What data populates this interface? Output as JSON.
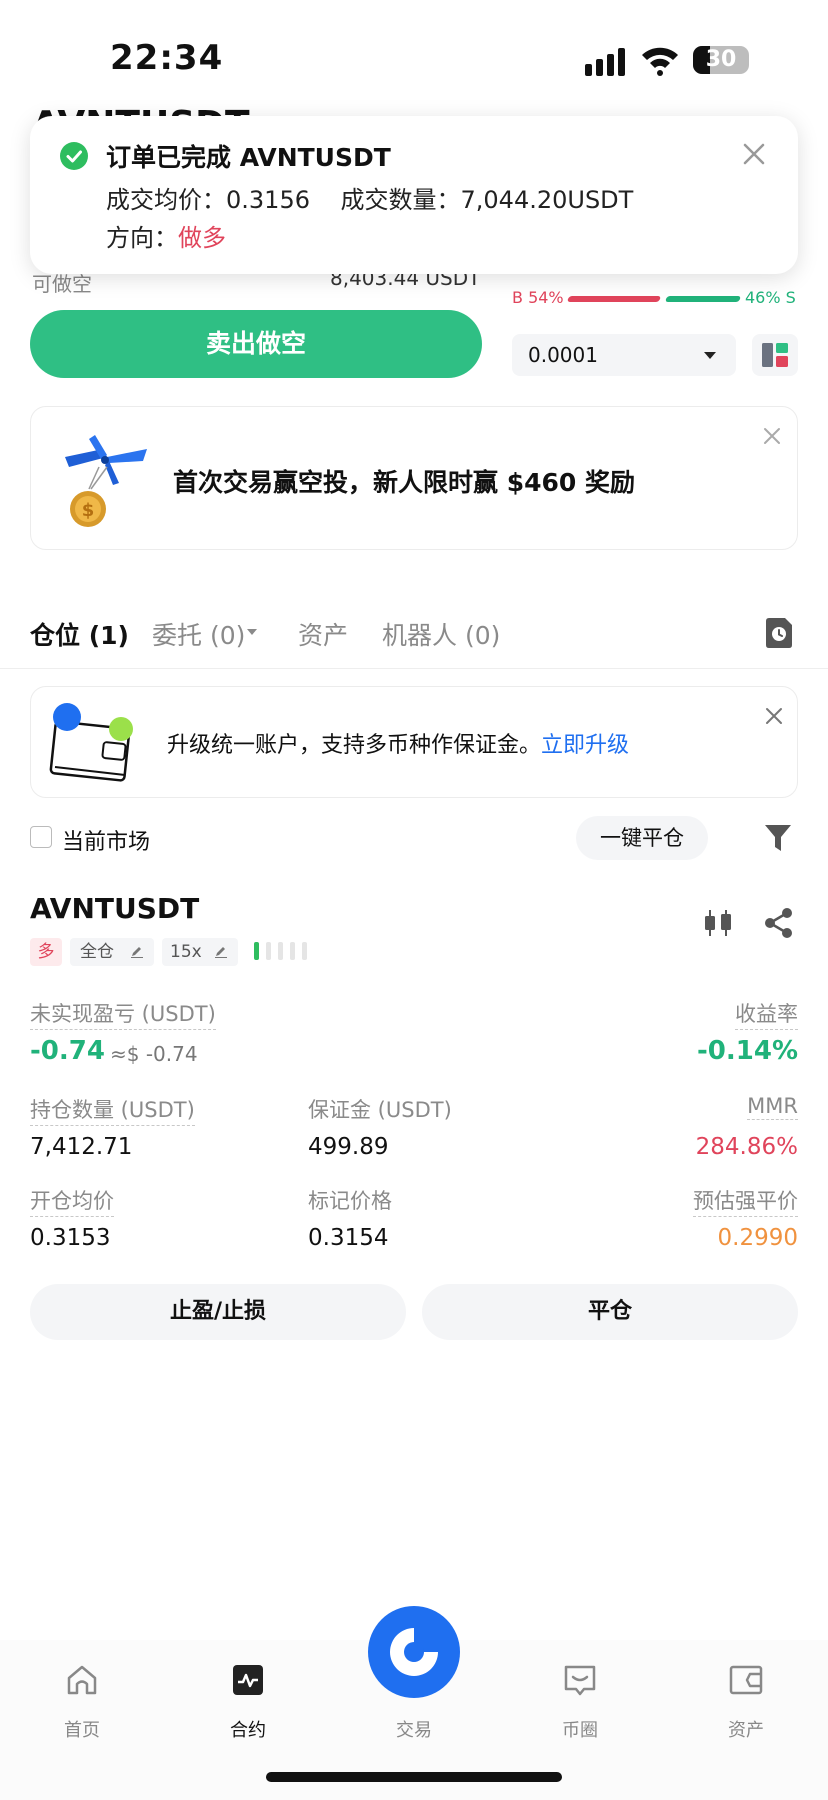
{
  "status_bar": {
    "time": "22:34",
    "battery": "30"
  },
  "header": {
    "pair": "AVNTUSDT"
  },
  "toast": {
    "title": "订单已完成 AVNTUSDT",
    "avg_price_label": "成交均价：",
    "avg_price": "0.3156",
    "qty_label": "成交数量：",
    "qty": "7,044.20USDT",
    "direction_label": "方向：",
    "direction": "做多"
  },
  "order_panel": {
    "available_label": "可做空",
    "available_value": "8,403.44 USDT",
    "buy_ratio": "B 54%",
    "sell_ratio": "46% S",
    "buy_ratio_fraction": 0.54,
    "sell_button": "卖出做空",
    "precision": "0.0001"
  },
  "promo": {
    "text": "首次交易赢空投，新人限时赢 $460 奖励"
  },
  "tabs": [
    {
      "label": "仓位 (1)"
    },
    {
      "label": "委托 (0)"
    },
    {
      "label": "资产"
    },
    {
      "label": "机器人 (0)"
    }
  ],
  "upgrade": {
    "text": "升级统一账户，支持多币种作保证金。",
    "link": "立即升级"
  },
  "filter_bar": {
    "current_market": "当前市场",
    "close_all": "一键平仓"
  },
  "position": {
    "symbol": "AVNTUSDT",
    "side_tag": "多",
    "margin_mode": "全仓",
    "leverage": "15x",
    "unrealized_pnl_label": "未实现盈亏 (USDT)",
    "unrealized_pnl": "-0.74",
    "unrealized_pnl_usd": "≈$ -0.74",
    "roe_label": "收益率",
    "roe": "-0.14%",
    "size_label": "持仓数量 (USDT)",
    "size": "7,412.71",
    "margin_label": "保证金 (USDT)",
    "margin": "499.89",
    "mmr_label": "MMR",
    "mmr": "284.86%",
    "entry_label": "开仓均价",
    "entry": "0.3153",
    "mark_label": "标记价格",
    "mark": "0.3154",
    "liq_label": "预估强平价",
    "liq": "0.2990",
    "tpsl_button": "止盈/止损",
    "close_button": "平仓"
  },
  "bottom_nav": [
    {
      "label": "首页",
      "icon": "home-icon"
    },
    {
      "label": "合约",
      "icon": "futures-icon"
    },
    {
      "label": "交易",
      "icon": "trade-icon"
    },
    {
      "label": "币圈",
      "icon": "community-icon"
    },
    {
      "label": "资产",
      "icon": "wallet-icon"
    }
  ],
  "colors": {
    "long": "#e0445b",
    "short": "#2fbf84",
    "accent": "#1f6ff0",
    "warn": "#f0923f"
  }
}
